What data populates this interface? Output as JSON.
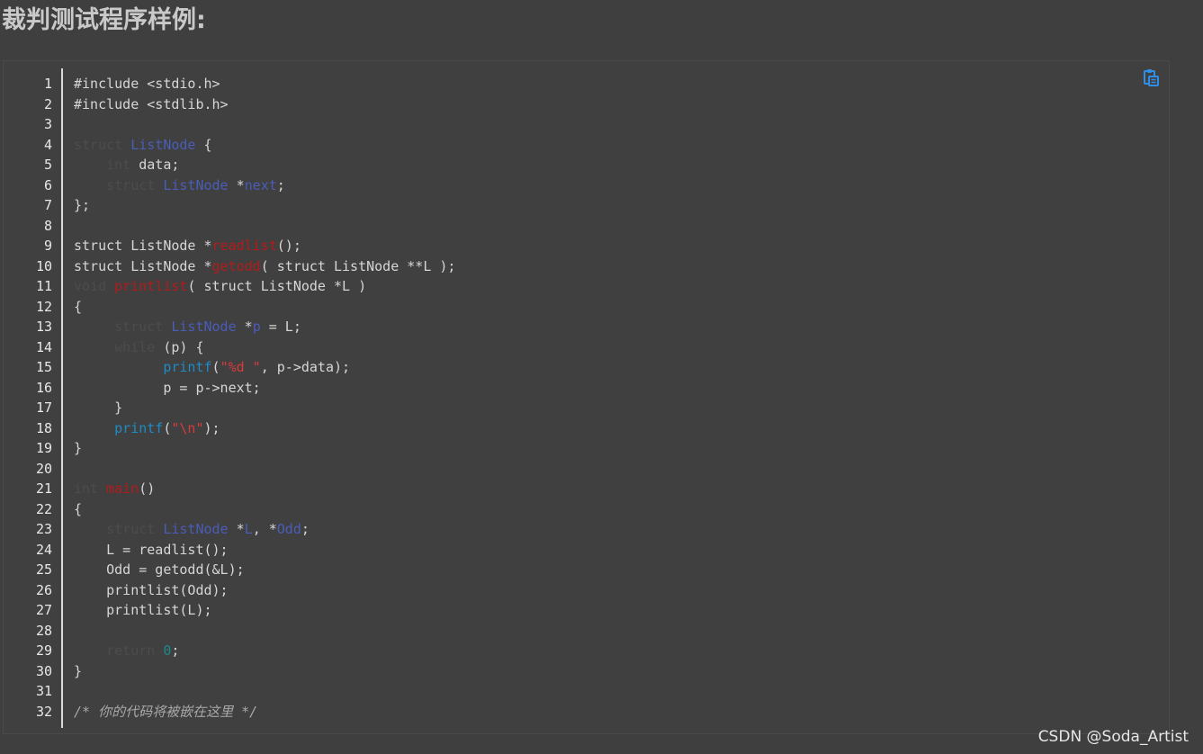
{
  "heading": "裁判测试程序样例:",
  "watermark": "CSDN @Soda_Artist",
  "copy_icon": "copy-clipboard-icon",
  "colors": {
    "keyword": "#4c4c4c",
    "type": "#4a5db7",
    "function": "#b31b1b",
    "library": "#1e8bc3",
    "string": "#d83b3b",
    "number": "#1a8a8a",
    "comment": "#a8a8a8",
    "plain": "#d6d6d6",
    "copy_icon": "#2f8ee8"
  },
  "code_lines": [
    {
      "n": "1",
      "tokens": [
        {
          "t": "plain",
          "v": "#include <stdio.h>"
        }
      ]
    },
    {
      "n": "2",
      "tokens": [
        {
          "t": "plain",
          "v": "#include <stdlib.h>"
        }
      ]
    },
    {
      "n": "3",
      "tokens": []
    },
    {
      "n": "4",
      "tokens": [
        {
          "t": "kw",
          "v": "struct"
        },
        {
          "t": "plain",
          "v": " "
        },
        {
          "t": "type",
          "v": "ListNode"
        },
        {
          "t": "plain",
          "v": " {"
        }
      ]
    },
    {
      "n": "5",
      "tokens": [
        {
          "t": "plain",
          "v": "    "
        },
        {
          "t": "kw",
          "v": "int"
        },
        {
          "t": "plain",
          "v": " data;"
        }
      ]
    },
    {
      "n": "6",
      "tokens": [
        {
          "t": "plain",
          "v": "    "
        },
        {
          "t": "kw",
          "v": "struct"
        },
        {
          "t": "plain",
          "v": " "
        },
        {
          "t": "type",
          "v": "ListNode"
        },
        {
          "t": "plain",
          "v": " *"
        },
        {
          "t": "type",
          "v": "next"
        },
        {
          "t": "plain",
          "v": ";"
        }
      ]
    },
    {
      "n": "7",
      "tokens": [
        {
          "t": "plain",
          "v": "};"
        }
      ]
    },
    {
      "n": "8",
      "tokens": []
    },
    {
      "n": "9",
      "tokens": [
        {
          "t": "plain",
          "v": "struct ListNode *"
        },
        {
          "t": "fn",
          "v": "readlist"
        },
        {
          "t": "plain",
          "v": "();"
        }
      ]
    },
    {
      "n": "10",
      "tokens": [
        {
          "t": "plain",
          "v": "struct ListNode *"
        },
        {
          "t": "fn",
          "v": "getodd"
        },
        {
          "t": "plain",
          "v": "( struct ListNode **L );"
        }
      ]
    },
    {
      "n": "11",
      "tokens": [
        {
          "t": "kw",
          "v": "void"
        },
        {
          "t": "plain",
          "v": " "
        },
        {
          "t": "fn",
          "v": "printlist"
        },
        {
          "t": "plain",
          "v": "( struct ListNode *L )"
        }
      ]
    },
    {
      "n": "12",
      "tokens": [
        {
          "t": "plain",
          "v": "{"
        }
      ]
    },
    {
      "n": "13",
      "tokens": [
        {
          "t": "plain",
          "v": "     "
        },
        {
          "t": "kw",
          "v": "struct"
        },
        {
          "t": "plain",
          "v": " "
        },
        {
          "t": "type",
          "v": "ListNode"
        },
        {
          "t": "plain",
          "v": " *"
        },
        {
          "t": "type",
          "v": "p"
        },
        {
          "t": "plain",
          "v": " = L;"
        }
      ]
    },
    {
      "n": "14",
      "tokens": [
        {
          "t": "plain",
          "v": "     "
        },
        {
          "t": "kw",
          "v": "while"
        },
        {
          "t": "plain",
          "v": " (p) {"
        }
      ]
    },
    {
      "n": "15",
      "tokens": [
        {
          "t": "plain",
          "v": "           "
        },
        {
          "t": "lib",
          "v": "printf"
        },
        {
          "t": "plain",
          "v": "("
        },
        {
          "t": "str",
          "v": "\"%d \""
        },
        {
          "t": "plain",
          "v": ", p->data);"
        }
      ]
    },
    {
      "n": "16",
      "tokens": [
        {
          "t": "plain",
          "v": "           p = p->next;"
        }
      ]
    },
    {
      "n": "17",
      "tokens": [
        {
          "t": "plain",
          "v": "     }"
        }
      ]
    },
    {
      "n": "18",
      "tokens": [
        {
          "t": "plain",
          "v": "     "
        },
        {
          "t": "lib",
          "v": "printf"
        },
        {
          "t": "plain",
          "v": "("
        },
        {
          "t": "str",
          "v": "\"\\n\""
        },
        {
          "t": "plain",
          "v": ");"
        }
      ]
    },
    {
      "n": "19",
      "tokens": [
        {
          "t": "plain",
          "v": "}"
        }
      ]
    },
    {
      "n": "20",
      "tokens": []
    },
    {
      "n": "21",
      "tokens": [
        {
          "t": "kw",
          "v": "int"
        },
        {
          "t": "plain",
          "v": " "
        },
        {
          "t": "fn",
          "v": "main"
        },
        {
          "t": "plain",
          "v": "()"
        }
      ]
    },
    {
      "n": "22",
      "tokens": [
        {
          "t": "plain",
          "v": "{"
        }
      ]
    },
    {
      "n": "23",
      "tokens": [
        {
          "t": "plain",
          "v": "    "
        },
        {
          "t": "kw",
          "v": "struct"
        },
        {
          "t": "plain",
          "v": " "
        },
        {
          "t": "type",
          "v": "ListNode"
        },
        {
          "t": "plain",
          "v": " *"
        },
        {
          "t": "type",
          "v": "L"
        },
        {
          "t": "plain",
          "v": ", *"
        },
        {
          "t": "type",
          "v": "Odd"
        },
        {
          "t": "plain",
          "v": ";"
        }
      ]
    },
    {
      "n": "24",
      "tokens": [
        {
          "t": "plain",
          "v": "    L = readlist();"
        }
      ]
    },
    {
      "n": "25",
      "tokens": [
        {
          "t": "plain",
          "v": "    Odd = getodd(&L);"
        }
      ]
    },
    {
      "n": "26",
      "tokens": [
        {
          "t": "plain",
          "v": "    printlist(Odd);"
        }
      ]
    },
    {
      "n": "27",
      "tokens": [
        {
          "t": "plain",
          "v": "    printlist(L);"
        }
      ]
    },
    {
      "n": "28",
      "tokens": []
    },
    {
      "n": "29",
      "tokens": [
        {
          "t": "plain",
          "v": "    "
        },
        {
          "t": "kw",
          "v": "return"
        },
        {
          "t": "plain",
          "v": " "
        },
        {
          "t": "num",
          "v": "0"
        },
        {
          "t": "plain",
          "v": ";"
        }
      ]
    },
    {
      "n": "30",
      "tokens": [
        {
          "t": "plain",
          "v": "}"
        }
      ]
    },
    {
      "n": "31",
      "tokens": []
    },
    {
      "n": "32",
      "tokens": [
        {
          "t": "cm",
          "v": "/* 你的代码将被嵌在这里 */"
        }
      ]
    }
  ]
}
